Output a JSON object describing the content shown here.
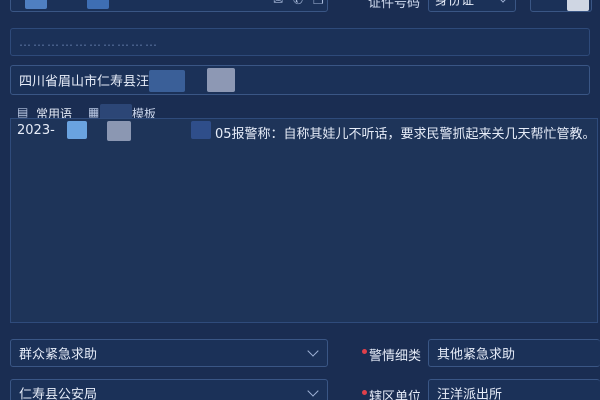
{
  "top": {
    "id_type_label": "证件号码",
    "id_type_value": "身份证"
  },
  "address_blurred_hint": "…………………………",
  "address": "四川省眉山市仁寿县汪",
  "toolbar": {
    "common_phrases": "常用语",
    "template": "模板"
  },
  "description": {
    "prefix": "2023-",
    "text": "05报警称：自称其娃儿不听话，要求民警抓起来关几天帮忙管教。"
  },
  "form": {
    "category_value": "群众紧急求助",
    "subcategory_label": "警情细类",
    "subcategory_value": "其他紧急求助",
    "dept_value": "仁寿县公安局",
    "district_label": "辖区单位",
    "district_value": "汪洋派出所"
  },
  "colors": {
    "background": "#1a2d52",
    "required": "#e0404b",
    "redaction_light": "#5b8fcf",
    "redaction_grey": "#8a96b3"
  }
}
